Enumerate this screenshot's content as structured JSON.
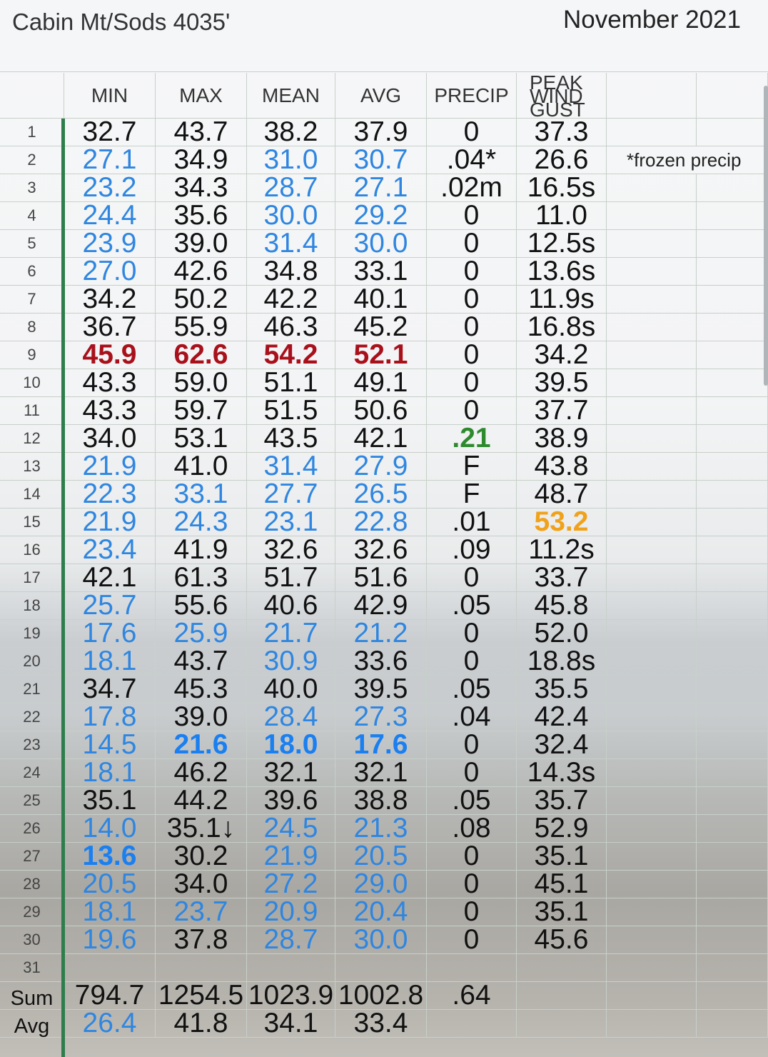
{
  "header": {
    "title": "Cabin Mt/Sods 4035'",
    "month": "November 2021"
  },
  "columns": [
    "MIN",
    "MAX",
    "MEAN",
    "AVG",
    "PRECIP",
    "PEAK WIND GUST"
  ],
  "note": "*frozen precip",
  "rows": [
    {
      "n": "1",
      "min": "32.7",
      "max": "43.7",
      "mean": "38.2",
      "avg": "37.9",
      "precip": "0",
      "gust": "37.3"
    },
    {
      "n": "2",
      "min": "27.1",
      "max": "34.9",
      "mean": "31.0",
      "avg": "30.7",
      "precip": ".04*",
      "gust": "26.6"
    },
    {
      "n": "3",
      "min": "23.2",
      "max": "34.3",
      "mean": "28.7",
      "avg": "27.1",
      "precip": ".02m",
      "gust": "16.5s"
    },
    {
      "n": "4",
      "min": "24.4",
      "max": "35.6",
      "mean": "30.0",
      "avg": "29.2",
      "precip": "0",
      "gust": "11.0"
    },
    {
      "n": "5",
      "min": "23.9",
      "max": "39.0",
      "mean": "31.4",
      "avg": "30.0",
      "precip": "0",
      "gust": "12.5s"
    },
    {
      "n": "6",
      "min": "27.0",
      "max": "42.6",
      "mean": "34.8",
      "avg": "33.1",
      "precip": "0",
      "gust": "13.6s"
    },
    {
      "n": "7",
      "min": "34.2",
      "max": "50.2",
      "mean": "42.2",
      "avg": "40.1",
      "precip": "0",
      "gust": "11.9s"
    },
    {
      "n": "8",
      "min": "36.7",
      "max": "55.9",
      "mean": "46.3",
      "avg": "45.2",
      "precip": "0",
      "gust": "16.8s"
    },
    {
      "n": "9",
      "min": "45.9",
      "max": "62.6",
      "mean": "54.2",
      "avg": "52.1",
      "precip": "0",
      "gust": "34.2"
    },
    {
      "n": "10",
      "min": "43.3",
      "max": "59.0",
      "mean": "51.1",
      "avg": "49.1",
      "precip": "0",
      "gust": "39.5"
    },
    {
      "n": "11",
      "min": "43.3",
      "max": "59.7",
      "mean": "51.5",
      "avg": "50.6",
      "precip": "0",
      "gust": "37.7"
    },
    {
      "n": "12",
      "min": "34.0",
      "max": "53.1",
      "mean": "43.5",
      "avg": "42.1",
      "precip": ".21",
      "gust": "38.9"
    },
    {
      "n": "13",
      "min": "21.9",
      "max": "41.0",
      "mean": "31.4",
      "avg": "27.9",
      "precip": "F",
      "gust": "43.8"
    },
    {
      "n": "14",
      "min": "22.3",
      "max": "33.1",
      "mean": "27.7",
      "avg": "26.5",
      "precip": "F",
      "gust": "48.7"
    },
    {
      "n": "15",
      "min": "21.9",
      "max": "24.3",
      "mean": "23.1",
      "avg": "22.8",
      "precip": ".01",
      "gust": "53.2"
    },
    {
      "n": "16",
      "min": "23.4",
      "max": "41.9",
      "mean": "32.6",
      "avg": "32.6",
      "precip": ".09",
      "gust": "11.2s"
    },
    {
      "n": "17",
      "min": "42.1",
      "max": "61.3",
      "mean": "51.7",
      "avg": "51.6",
      "precip": "0",
      "gust": "33.7"
    },
    {
      "n": "18",
      "min": "25.7",
      "max": "55.6",
      "mean": "40.6",
      "avg": "42.9",
      "precip": ".05",
      "gust": "45.8"
    },
    {
      "n": "19",
      "min": "17.6",
      "max": "25.9",
      "mean": "21.7",
      "avg": "21.2",
      "precip": "0",
      "gust": "52.0"
    },
    {
      "n": "20",
      "min": "18.1",
      "max": "43.7",
      "mean": "30.9",
      "avg": "33.6",
      "precip": "0",
      "gust": "18.8s"
    },
    {
      "n": "21",
      "min": "34.7",
      "max": "45.3",
      "mean": "40.0",
      "avg": "39.5",
      "precip": ".05",
      "gust": "35.5"
    },
    {
      "n": "22",
      "min": "17.8",
      "max": "39.0",
      "mean": "28.4",
      "avg": "27.3",
      "precip": ".04",
      "gust": "42.4"
    },
    {
      "n": "23",
      "min": "14.5",
      "max": "21.6",
      "mean": "18.0",
      "avg": "17.6",
      "precip": "0",
      "gust": "32.4"
    },
    {
      "n": "24",
      "min": "18.1",
      "max": "46.2",
      "mean": "32.1",
      "avg": "32.1",
      "precip": "0",
      "gust": "14.3s"
    },
    {
      "n": "25",
      "min": "35.1",
      "max": "44.2",
      "mean": "39.6",
      "avg": "38.8",
      "precip": ".05",
      "gust": "35.7"
    },
    {
      "n": "26",
      "min": "14.0",
      "max": "35.1↓",
      "mean": "24.5",
      "avg": "21.3",
      "precip": ".08",
      "gust": "52.9"
    },
    {
      "n": "27",
      "min": "13.6",
      "max": "30.2",
      "mean": "21.9",
      "avg": "20.5",
      "precip": "0",
      "gust": "35.1"
    },
    {
      "n": "28",
      "min": "20.5",
      "max": "34.0",
      "mean": "27.2",
      "avg": "29.0",
      "precip": "0",
      "gust": "45.1"
    },
    {
      "n": "29",
      "min": "18.1",
      "max": "23.7",
      "mean": "20.9",
      "avg": "20.4",
      "precip": "0",
      "gust": "35.1"
    },
    {
      "n": "30",
      "min": "19.6",
      "max": "37.8",
      "mean": "28.7",
      "avg": "30.0",
      "precip": "0",
      "gust": "45.6"
    },
    {
      "n": "31",
      "min": "",
      "max": "",
      "mean": "",
      "avg": "",
      "precip": "",
      "gust": ""
    }
  ],
  "sum": {
    "label": "Sum",
    "min": "794.7",
    "max": "1254.5",
    "mean": "1023.9",
    "avg": "1002.8",
    "precip": ".64"
  },
  "avg": {
    "label": "Avg",
    "min": "26.4",
    "max": "41.8",
    "mean": "34.1",
    "avg": "33.4"
  },
  "colors": {
    "blue": "#2f86e0",
    "red": "#a8111b",
    "green": "#2d8a2d",
    "orange": "#f0a21b",
    "bar": "#2e7d4c"
  }
}
